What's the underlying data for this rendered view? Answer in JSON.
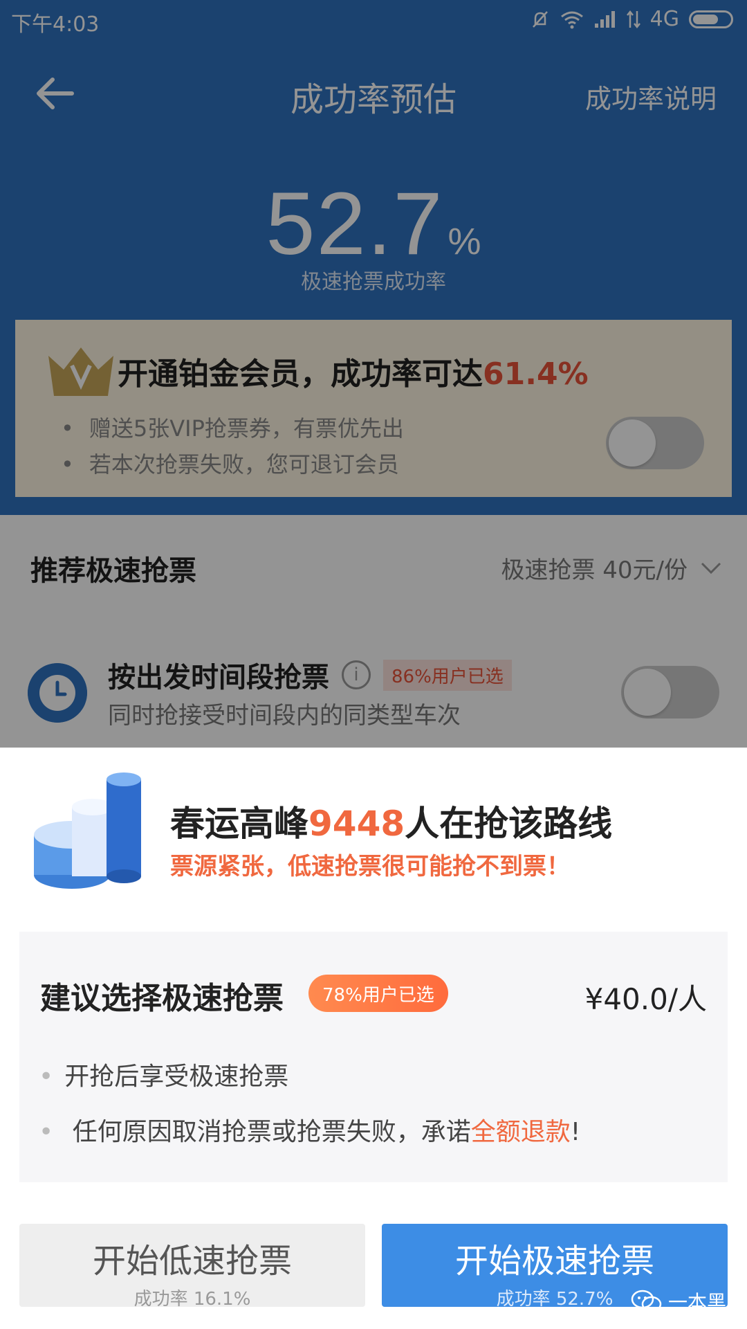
{
  "status_bar": {
    "time": "下午4:03",
    "network": "4G"
  },
  "nav": {
    "title": "成功率预估",
    "help": "成功率说明"
  },
  "rate": {
    "value": "52.7",
    "unit": "%",
    "caption": "极速抢票成功率"
  },
  "vip": {
    "title": "开通铂金会员，成功率可达",
    "rate": "61.4%",
    "bullets": [
      "赠送5张VIP抢票券，有票优先出",
      "若本次抢票失败，您可退订会员"
    ],
    "toggle_on": false
  },
  "recommend": {
    "title": "推荐极速抢票",
    "select": "极速抢票 40元/份"
  },
  "time_segment": {
    "title": "按出发时间段抢票",
    "info_icon": "i",
    "badge": "86%用户已选",
    "subtitle": "同时抢接受时间段内的同类型车次",
    "toggle_on": false
  },
  "popup": {
    "headline_prefix": "春运高峰",
    "headline_count": "9448",
    "headline_suffix": "人在抢该路线",
    "warning": "票源紧张，低速抢票很可能抢不到票！",
    "suggest": {
      "title": "建议选择极速抢票",
      "badge": "78%用户已选",
      "price": "¥40.0/人",
      "feature1": "开抢后享受极速抢票",
      "feature2_prefix": "任何原因取消抢票或抢票失败，承诺",
      "feature2_highlight": "全额退款",
      "feature2_suffix": "!"
    },
    "btn_slow": {
      "label": "开始低速抢票",
      "sub": "成功率 16.1%"
    },
    "btn_fast": {
      "label": "开始极速抢票",
      "sub": "成功率 52.7%"
    }
  },
  "watermark": "一本黑",
  "colors": {
    "primary": "#2f72c0",
    "button_blue": "#3d8de5",
    "accent": "#f0683f",
    "vip_red": "#e8533a"
  }
}
